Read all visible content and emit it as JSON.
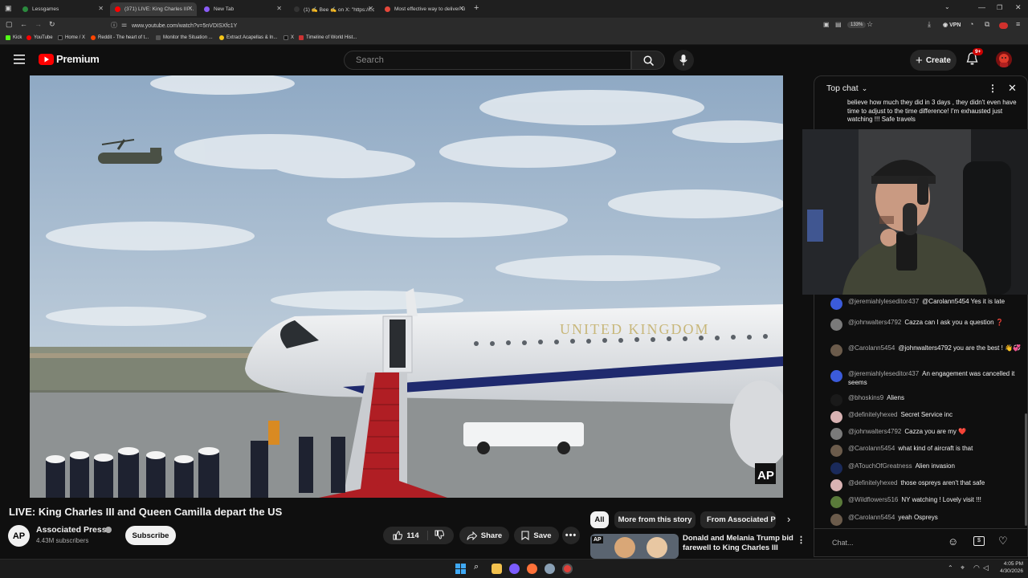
{
  "browser": {
    "tabs": [
      {
        "label": "Lessgames",
        "color": "#2b8a3e"
      },
      {
        "label": "(371) LIVE: King Charles III ...",
        "color": "#ff0000"
      },
      {
        "label": "New Tab",
        "color": "#8a5cf6"
      },
      {
        "label": "(1) ✍ Bee ✍ on X: \"https://t.c",
        "color": "#333333"
      },
      {
        "label": "Most effective way to deliver G",
        "color": "#e5483b"
      }
    ],
    "url": "www.youtube.com/watch?v=5nVDISXfc1Y",
    "zoom": "133%",
    "vpn_label": "VPN",
    "bookmarks": [
      {
        "label": "Kick",
        "color": "#53fc18"
      },
      {
        "label": "YouTube",
        "color": "#ff0000"
      },
      {
        "label": "Home / X",
        "color": "#111111"
      },
      {
        "label": "Reddit - The heart of t...",
        "color": "#ff4500"
      },
      {
        "label": "Monitor the Situation ...",
        "color": "#555555"
      },
      {
        "label": "Extract Acapellas & In...",
        "color": "#f5c518"
      },
      {
        "label": "X",
        "color": "#111111"
      },
      {
        "label": "Timeline of World Hist...",
        "color": "#cc3333"
      }
    ]
  },
  "youtube": {
    "logo_text": "Premium",
    "search_placeholder": "Search",
    "create_label": "Create",
    "notification_count": "9+"
  },
  "video": {
    "title": "LIVE: King Charles III and Queen Camilla depart the US",
    "plane_text": "UNITED KINGDOM",
    "watermark": "AP",
    "channel_name": "Associated Press",
    "subscribers": "4.43M subscribers",
    "subscribe_label": "Subscribe",
    "likes": "114",
    "share_label": "Share",
    "save_label": "Save"
  },
  "related": {
    "chips": [
      "All",
      "More from this story",
      "From Associated Pr"
    ],
    "first_title": "Donald and Melania Trump bid farewell to King Charles III and...",
    "first_badge": "AP"
  },
  "chat": {
    "header": "Top chat",
    "pinned_text": "believe how much they did in 3 days , they didn't even have time to adjust to the time difference! I'm exhausted just watching !!! Safe travels",
    "input_placeholder": "Chat...",
    "messages": [
      {
        "author": "@jeremiahlyleseditor437",
        "text": "@Carolann5454 Yes it is late",
        "color": "#3b5bdb"
      },
      {
        "author": "@johnwalters4792",
        "text": "Cazza can I ask you a question ❓",
        "color": "#7a7a7a"
      },
      {
        "author": "@Carolann5454",
        "text": "@johnwalters4792 you are the best ! 👋💞",
        "color": "#6b5b4b"
      },
      {
        "author": "@jeremiahlyleseditor437",
        "text": "An engagement was cancelled it seems",
        "color": "#3b5bdb"
      },
      {
        "author": "@bhoskins9",
        "text": "Aliens",
        "color": "#1a1a1a"
      },
      {
        "author": "@definitelyhexed",
        "text": "Secret Service inc",
        "color": "#d9b3b3"
      },
      {
        "author": "@johnwalters4792",
        "text": "Cazza you are my ❤️",
        "color": "#7a7a7a"
      },
      {
        "author": "@Carolann5454",
        "text": "what kind of aircraft is that",
        "color": "#6b5b4b"
      },
      {
        "author": "@ATouchOfGreatness",
        "text": "Alien invasion",
        "color": "#1a2a5a"
      },
      {
        "author": "@definitelyhexed",
        "text": "those ospreys aren't that safe",
        "color": "#d9b3b3"
      },
      {
        "author": "@Wildflowers516",
        "text": "NY watching ! Lovely visit !!!",
        "color": "#5a7a3a"
      },
      {
        "author": "@Carolann5454",
        "text": "yeah Ospreys",
        "color": "#6b5b4b"
      }
    ]
  },
  "taskbar": {
    "time": "4:05 PM",
    "date": "4/30/2026"
  }
}
